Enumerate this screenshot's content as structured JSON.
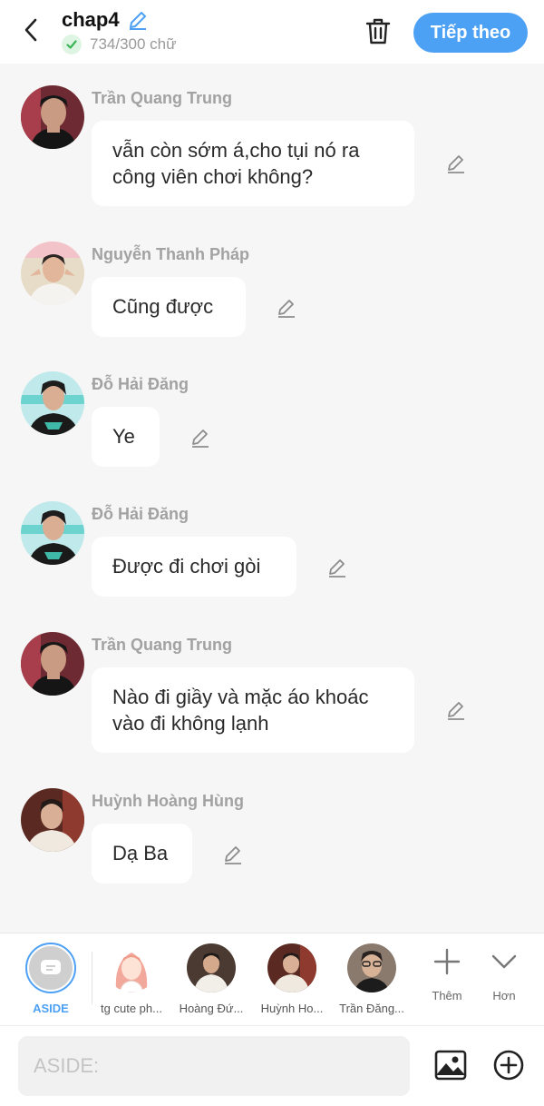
{
  "header": {
    "title": "chap4",
    "word_count": "734/300 chữ",
    "next_label": "Tiếp theo",
    "accent_color": "#4da1f4"
  },
  "messages": [
    {
      "name": "Trần Quang Trung",
      "text": "vẫn còn sớm á,cho tụi nó ra công viên chơi không?"
    },
    {
      "name": "Nguyễn Thanh Pháp",
      "text": "Cũng được"
    },
    {
      "name": "Đỗ Hải Đăng",
      "text": "Ye"
    },
    {
      "name": "Đỗ Hải Đăng",
      "text": "Được đi chơi gòi"
    },
    {
      "name": "Trần Quang Trung",
      "text": "Nào đi giầy và mặc áo khoác vào đi không lạnh"
    },
    {
      "name": "Huỳnh Hoàng Hùng",
      "text": "Dạ Ba"
    }
  ],
  "characters": {
    "aside_label": "ASIDE",
    "items": [
      {
        "label": "tg cute ph..."
      },
      {
        "label": "Hoàng Đứ..."
      },
      {
        "label": "Huỳnh Ho..."
      },
      {
        "label": "Trần Đăng..."
      }
    ],
    "add_label": "Thêm",
    "more_label": "Hơn"
  },
  "composer": {
    "placeholder": "ASIDE:"
  }
}
